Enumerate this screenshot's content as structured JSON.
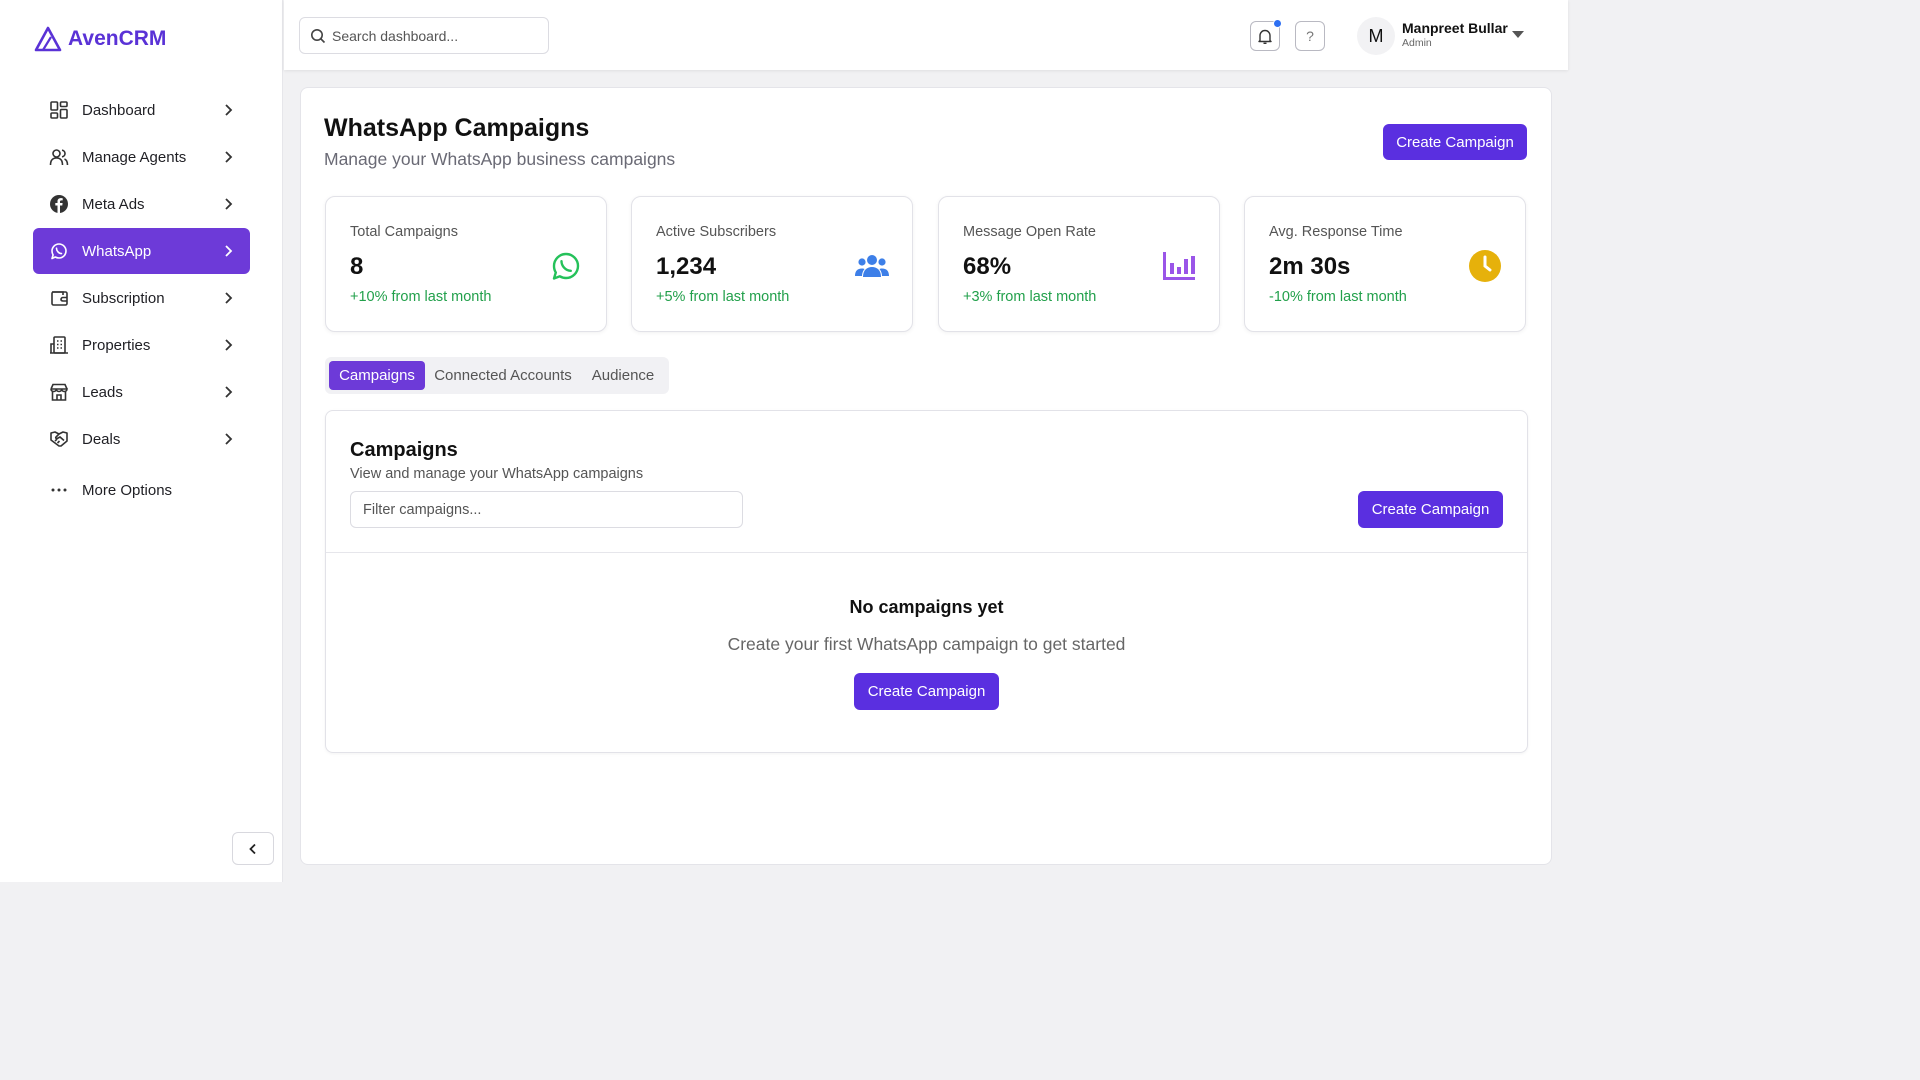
{
  "brand": {
    "name": "AvenCRM",
    "color": "#5a32d6"
  },
  "sidebar": {
    "items": [
      {
        "label": "Dashboard",
        "icon": "grid-icon"
      },
      {
        "label": "Manage Agents",
        "icon": "users-icon"
      },
      {
        "label": "Meta Ads",
        "icon": "facebook-icon"
      },
      {
        "label": "WhatsApp",
        "icon": "whatsapp-icon",
        "active": true
      },
      {
        "label": "Subscription",
        "icon": "wallet-icon"
      },
      {
        "label": "Properties",
        "icon": "building-icon"
      },
      {
        "label": "Leads",
        "icon": "store-icon"
      },
      {
        "label": "Deals",
        "icon": "handshake-icon"
      }
    ],
    "more_label": "More Options",
    "active_color": "#6d3ad8"
  },
  "topbar": {
    "search_placeholder": "Search dashboard...",
    "user": {
      "initial": "M",
      "name": "Manpreet Bullar",
      "role": "Admin"
    },
    "help_symbol": "?"
  },
  "page": {
    "title": "WhatsApp Campaigns",
    "subtitle": "Manage your WhatsApp business campaigns",
    "create_label": "Create Campaign",
    "accent": "#5a2fe0"
  },
  "stats": [
    {
      "label": "Total Campaigns",
      "value": "8",
      "change": "+10% from last month",
      "icon": "whatsapp-icon"
    },
    {
      "label": "Active Subscribers",
      "value": "1,234",
      "change": "+5% from last month",
      "icon": "users-icon"
    },
    {
      "label": "Message Open Rate",
      "value": "68%",
      "change": "+3% from last month",
      "icon": "bar-chart-icon"
    },
    {
      "label": "Avg. Response Time",
      "value": "2m 30s",
      "change": "-10% from last month",
      "icon": "clock-icon"
    }
  ],
  "tabs": [
    {
      "label": "Campaigns",
      "active": true
    },
    {
      "label": "Connected Accounts"
    },
    {
      "label": "Audience"
    }
  ],
  "campaigns_panel": {
    "title": "Campaigns",
    "subtitle": "View and manage your WhatsApp campaigns",
    "filter_placeholder": "Filter campaigns...",
    "create_label": "Create Campaign",
    "empty_title": "No campaigns yet",
    "empty_subtitle": "Create your first WhatsApp campaign to get started",
    "empty_button_label": "Create Campaign"
  }
}
